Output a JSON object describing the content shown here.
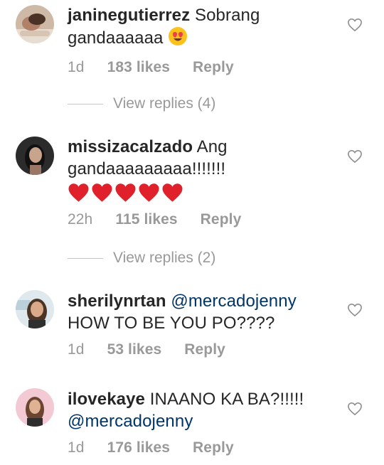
{
  "comments": [
    {
      "username": "janinegutierrez",
      "text_line1": "Sobrang",
      "text_line2": "gandaaaaaa",
      "emoji": "heart-eyes",
      "time": "1d",
      "likes": "183 likes",
      "reply": "Reply"
    },
    {
      "username": "missizacalzado",
      "text_line1": "Ang",
      "text_line2": "gandaaaaaaaaa!!!!!!!",
      "emoji": "red-heart-x5",
      "time": "22h",
      "likes": "115 likes",
      "reply": "Reply"
    },
    {
      "username": "sherilynrtan",
      "mention": "@mercadojenny",
      "text_line2": "HOW TO BE YOU PO????",
      "time": "1d",
      "likes": "53 likes",
      "reply": "Reply"
    },
    {
      "username": "ilovekaye",
      "text_line1": "INAANO KA BA?!!!!!",
      "mention": "@mercadojenny",
      "time": "1d",
      "likes": "176 likes",
      "reply": "Reply"
    }
  ],
  "view_replies": [
    "View replies (4)",
    "View replies (2)"
  ],
  "colors": {
    "text": "#262626",
    "meta": "#999999",
    "mention": "#003569",
    "heart_outline": "#8e8e8e"
  },
  "icons": {
    "like": "heart-outline-icon"
  }
}
